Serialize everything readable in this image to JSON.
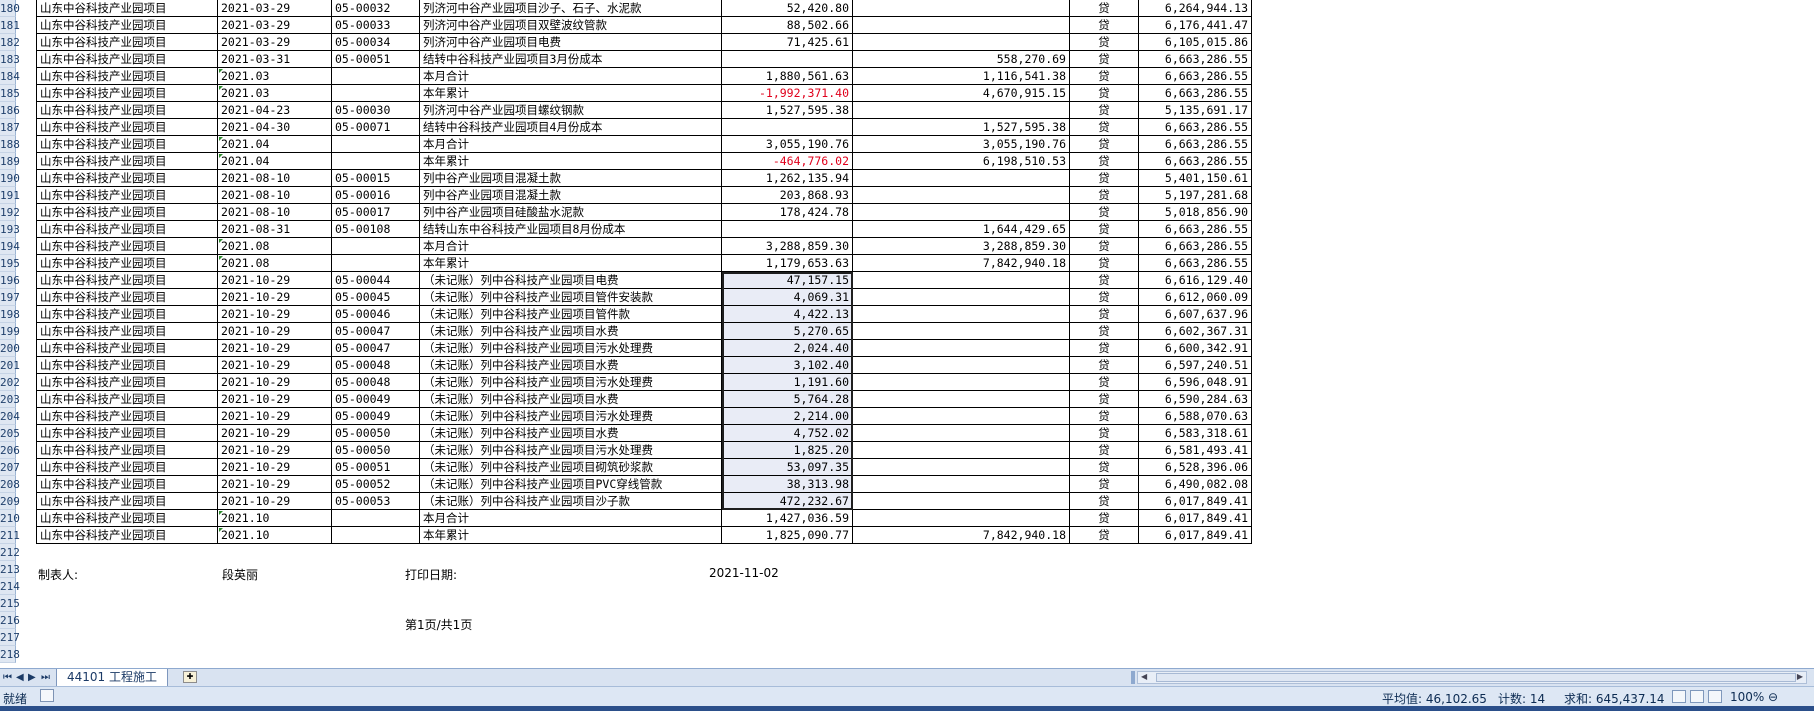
{
  "rows": [
    {
      "n": "180",
      "entity": "山东中谷科技产业园项目",
      "date": "2021-03-29",
      "voucher": "05-00032",
      "summary": "列济河中谷产业园项目沙子、石子、水泥款",
      "debit": "52,420.80",
      "credit": "",
      "dir": "贷",
      "balance": "6,264,944.13"
    },
    {
      "n": "181",
      "entity": "山东中谷科技产业园项目",
      "date": "2021-03-29",
      "voucher": "05-00033",
      "summary": "列济河中谷产业园项目双壁波纹管款",
      "debit": "88,502.66",
      "credit": "",
      "dir": "贷",
      "balance": "6,176,441.47"
    },
    {
      "n": "182",
      "entity": "山东中谷科技产业园项目",
      "date": "2021-03-29",
      "voucher": "05-00034",
      "summary": "列济河中谷产业园项目电费",
      "debit": "71,425.61",
      "credit": "",
      "dir": "贷",
      "balance": "6,105,015.86"
    },
    {
      "n": "183",
      "entity": "山东中谷科技产业园项目",
      "date": "2021-03-31",
      "voucher": "05-00051",
      "summary": "结转中谷科技产业园项目3月份成本",
      "debit": "",
      "credit": "558,270.69",
      "dir": "贷",
      "balance": "6,663,286.55"
    },
    {
      "n": "184",
      "entity": "山东中谷科技产业园项目",
      "date": "2021.03",
      "voucher": "",
      "summary": "本月合计",
      "debit": "1,880,561.63",
      "credit": "1,116,541.38",
      "dir": "贷",
      "balance": "6,663,286.55",
      "mark": true
    },
    {
      "n": "185",
      "entity": "山东中谷科技产业园项目",
      "date": "2021.03",
      "voucher": "",
      "summary": "本年累计",
      "debit": "-1,992,371.40",
      "credit": "4,670,915.15",
      "dir": "贷",
      "balance": "6,663,286.55",
      "mark": true,
      "neg": true
    },
    {
      "n": "186",
      "entity": "山东中谷科技产业园项目",
      "date": "2021-04-23",
      "voucher": "05-00030",
      "summary": "列济河中谷产业园项目螺纹钢款",
      "debit": "1,527,595.38",
      "credit": "",
      "dir": "贷",
      "balance": "5,135,691.17"
    },
    {
      "n": "187",
      "entity": "山东中谷科技产业园项目",
      "date": "2021-04-30",
      "voucher": "05-00071",
      "summary": "结转中谷科技产业园项目4月份成本",
      "debit": "",
      "credit": "1,527,595.38",
      "dir": "贷",
      "balance": "6,663,286.55"
    },
    {
      "n": "188",
      "entity": "山东中谷科技产业园项目",
      "date": "2021.04",
      "voucher": "",
      "summary": "本月合计",
      "debit": "3,055,190.76",
      "credit": "3,055,190.76",
      "dir": "贷",
      "balance": "6,663,286.55",
      "mark": true
    },
    {
      "n": "189",
      "entity": "山东中谷科技产业园项目",
      "date": "2021.04",
      "voucher": "",
      "summary": "本年累计",
      "debit": "-464,776.02",
      "credit": "6,198,510.53",
      "dir": "贷",
      "balance": "6,663,286.55",
      "mark": true,
      "neg": true
    },
    {
      "n": "190",
      "entity": "山东中谷科技产业园项目",
      "date": "2021-08-10",
      "voucher": "05-00015",
      "summary": "列中谷产业园项目混凝土款",
      "debit": "1,262,135.94",
      "credit": "",
      "dir": "贷",
      "balance": "5,401,150.61"
    },
    {
      "n": "191",
      "entity": "山东中谷科技产业园项目",
      "date": "2021-08-10",
      "voucher": "05-00016",
      "summary": "列中谷产业园项目混凝土款",
      "debit": "203,868.93",
      "credit": "",
      "dir": "贷",
      "balance": "5,197,281.68"
    },
    {
      "n": "192",
      "entity": "山东中谷科技产业园项目",
      "date": "2021-08-10",
      "voucher": "05-00017",
      "summary": "列中谷产业园项目硅酸盐水泥款",
      "debit": "178,424.78",
      "credit": "",
      "dir": "贷",
      "balance": "5,018,856.90"
    },
    {
      "n": "193",
      "entity": "山东中谷科技产业园项目",
      "date": "2021-08-31",
      "voucher": "05-00108",
      "summary": "结转山东中谷科技产业园项目8月份成本",
      "debit": "",
      "credit": "1,644,429.65",
      "dir": "贷",
      "balance": "6,663,286.55"
    },
    {
      "n": "194",
      "entity": "山东中谷科技产业园项目",
      "date": "2021.08",
      "voucher": "",
      "summary": "本月合计",
      "debit": "3,288,859.30",
      "credit": "3,288,859.30",
      "dir": "贷",
      "balance": "6,663,286.55",
      "mark": true
    },
    {
      "n": "195",
      "entity": "山东中谷科技产业园项目",
      "date": "2021.08",
      "voucher": "",
      "summary": "本年累计",
      "debit": "1,179,653.63",
      "credit": "7,842,940.18",
      "dir": "贷",
      "balance": "6,663,286.55",
      "mark": true
    },
    {
      "n": "196",
      "entity": "山东中谷科技产业园项目",
      "date": "2021-10-29",
      "voucher": "05-00044",
      "summary": "（未记账）列中谷科技产业园项目电费",
      "debit": "47,157.15",
      "credit": "",
      "dir": "贷",
      "balance": "6,616,129.40",
      "sel": true
    },
    {
      "n": "197",
      "entity": "山东中谷科技产业园项目",
      "date": "2021-10-29",
      "voucher": "05-00045",
      "summary": "（未记账）列中谷科技产业园项目管件安装款",
      "debit": "4,069.31",
      "credit": "",
      "dir": "贷",
      "balance": "6,612,060.09",
      "sel": true
    },
    {
      "n": "198",
      "entity": "山东中谷科技产业园项目",
      "date": "2021-10-29",
      "voucher": "05-00046",
      "summary": "（未记账）列中谷科技产业园项目管件款",
      "debit": "4,422.13",
      "credit": "",
      "dir": "贷",
      "balance": "6,607,637.96",
      "sel": true
    },
    {
      "n": "199",
      "entity": "山东中谷科技产业园项目",
      "date": "2021-10-29",
      "voucher": "05-00047",
      "summary": "（未记账）列中谷科技产业园项目水费",
      "debit": "5,270.65",
      "credit": "",
      "dir": "贷",
      "balance": "6,602,367.31",
      "sel": true
    },
    {
      "n": "200",
      "entity": "山东中谷科技产业园项目",
      "date": "2021-10-29",
      "voucher": "05-00047",
      "summary": "（未记账）列中谷科技产业园项目污水处理费",
      "debit": "2,024.40",
      "credit": "",
      "dir": "贷",
      "balance": "6,600,342.91",
      "sel": true
    },
    {
      "n": "201",
      "entity": "山东中谷科技产业园项目",
      "date": "2021-10-29",
      "voucher": "05-00048",
      "summary": "（未记账）列中谷科技产业园项目水费",
      "debit": "3,102.40",
      "credit": "",
      "dir": "贷",
      "balance": "6,597,240.51",
      "sel": true
    },
    {
      "n": "202",
      "entity": "山东中谷科技产业园项目",
      "date": "2021-10-29",
      "voucher": "05-00048",
      "summary": "（未记账）列中谷科技产业园项目污水处理费",
      "debit": "1,191.60",
      "credit": "",
      "dir": "贷",
      "balance": "6,596,048.91",
      "sel": true
    },
    {
      "n": "203",
      "entity": "山东中谷科技产业园项目",
      "date": "2021-10-29",
      "voucher": "05-00049",
      "summary": "（未记账）列中谷科技产业园项目水费",
      "debit": "5,764.28",
      "credit": "",
      "dir": "贷",
      "balance": "6,590,284.63",
      "sel": true
    },
    {
      "n": "204",
      "entity": "山东中谷科技产业园项目",
      "date": "2021-10-29",
      "voucher": "05-00049",
      "summary": "（未记账）列中谷科技产业园项目污水处理费",
      "debit": "2,214.00",
      "credit": "",
      "dir": "贷",
      "balance": "6,588,070.63",
      "sel": true
    },
    {
      "n": "205",
      "entity": "山东中谷科技产业园项目",
      "date": "2021-10-29",
      "voucher": "05-00050",
      "summary": "（未记账）列中谷科技产业园项目水费",
      "debit": "4,752.02",
      "credit": "",
      "dir": "贷",
      "balance": "6,583,318.61",
      "sel": true
    },
    {
      "n": "206",
      "entity": "山东中谷科技产业园项目",
      "date": "2021-10-29",
      "voucher": "05-00050",
      "summary": "（未记账）列中谷科技产业园项目污水处理费",
      "debit": "1,825.20",
      "credit": "",
      "dir": "贷",
      "balance": "6,581,493.41",
      "sel": true
    },
    {
      "n": "207",
      "entity": "山东中谷科技产业园项目",
      "date": "2021-10-29",
      "voucher": "05-00051",
      "summary": "（未记账）列中谷科技产业园项目砌筑砂浆款",
      "debit": "53,097.35",
      "credit": "",
      "dir": "贷",
      "balance": "6,528,396.06",
      "sel": true
    },
    {
      "n": "208",
      "entity": "山东中谷科技产业园项目",
      "date": "2021-10-29",
      "voucher": "05-00052",
      "summary": "（未记账）列中谷科技产业园项目PVC穿线管款",
      "debit": "38,313.98",
      "credit": "",
      "dir": "贷",
      "balance": "6,490,082.08",
      "sel": true
    },
    {
      "n": "209",
      "entity": "山东中谷科技产业园项目",
      "date": "2021-10-29",
      "voucher": "05-00053",
      "summary": "（未记账）列中谷科技产业园项目沙子款",
      "debit": "472,232.67",
      "credit": "",
      "dir": "贷",
      "balance": "6,017,849.41",
      "sel": true
    },
    {
      "n": "210",
      "entity": "山东中谷科技产业园项目",
      "date": "2021.10",
      "voucher": "",
      "summary": "本月合计",
      "debit": "1,427,036.59",
      "credit": "",
      "dir": "贷",
      "balance": "6,017,849.41",
      "mark": true
    },
    {
      "n": "211",
      "entity": "山东中谷科技产业园项目",
      "date": "2021.10",
      "voucher": "",
      "summary": "本年累计",
      "debit": "1,825,090.77",
      "credit": "7,842,940.18",
      "dir": "贷",
      "balance": "6,017,849.41",
      "mark": true
    }
  ],
  "empty_rows": [
    "212",
    "213",
    "214",
    "215",
    "216",
    "217",
    "218"
  ],
  "footer": {
    "maker_label": "制表人:",
    "maker_name": "段英丽",
    "print_date_label": "打印日期:",
    "print_date": "2021-11-02",
    "page_info": "第1页/共1页"
  },
  "sheet_tab": {
    "label": "44101 工程施工"
  },
  "status": {
    "ready": "就绪",
    "average": "平均值: 46,102.65",
    "count": "计数: 14",
    "sum": "求和: 645,437.14",
    "zoom": "100%"
  }
}
